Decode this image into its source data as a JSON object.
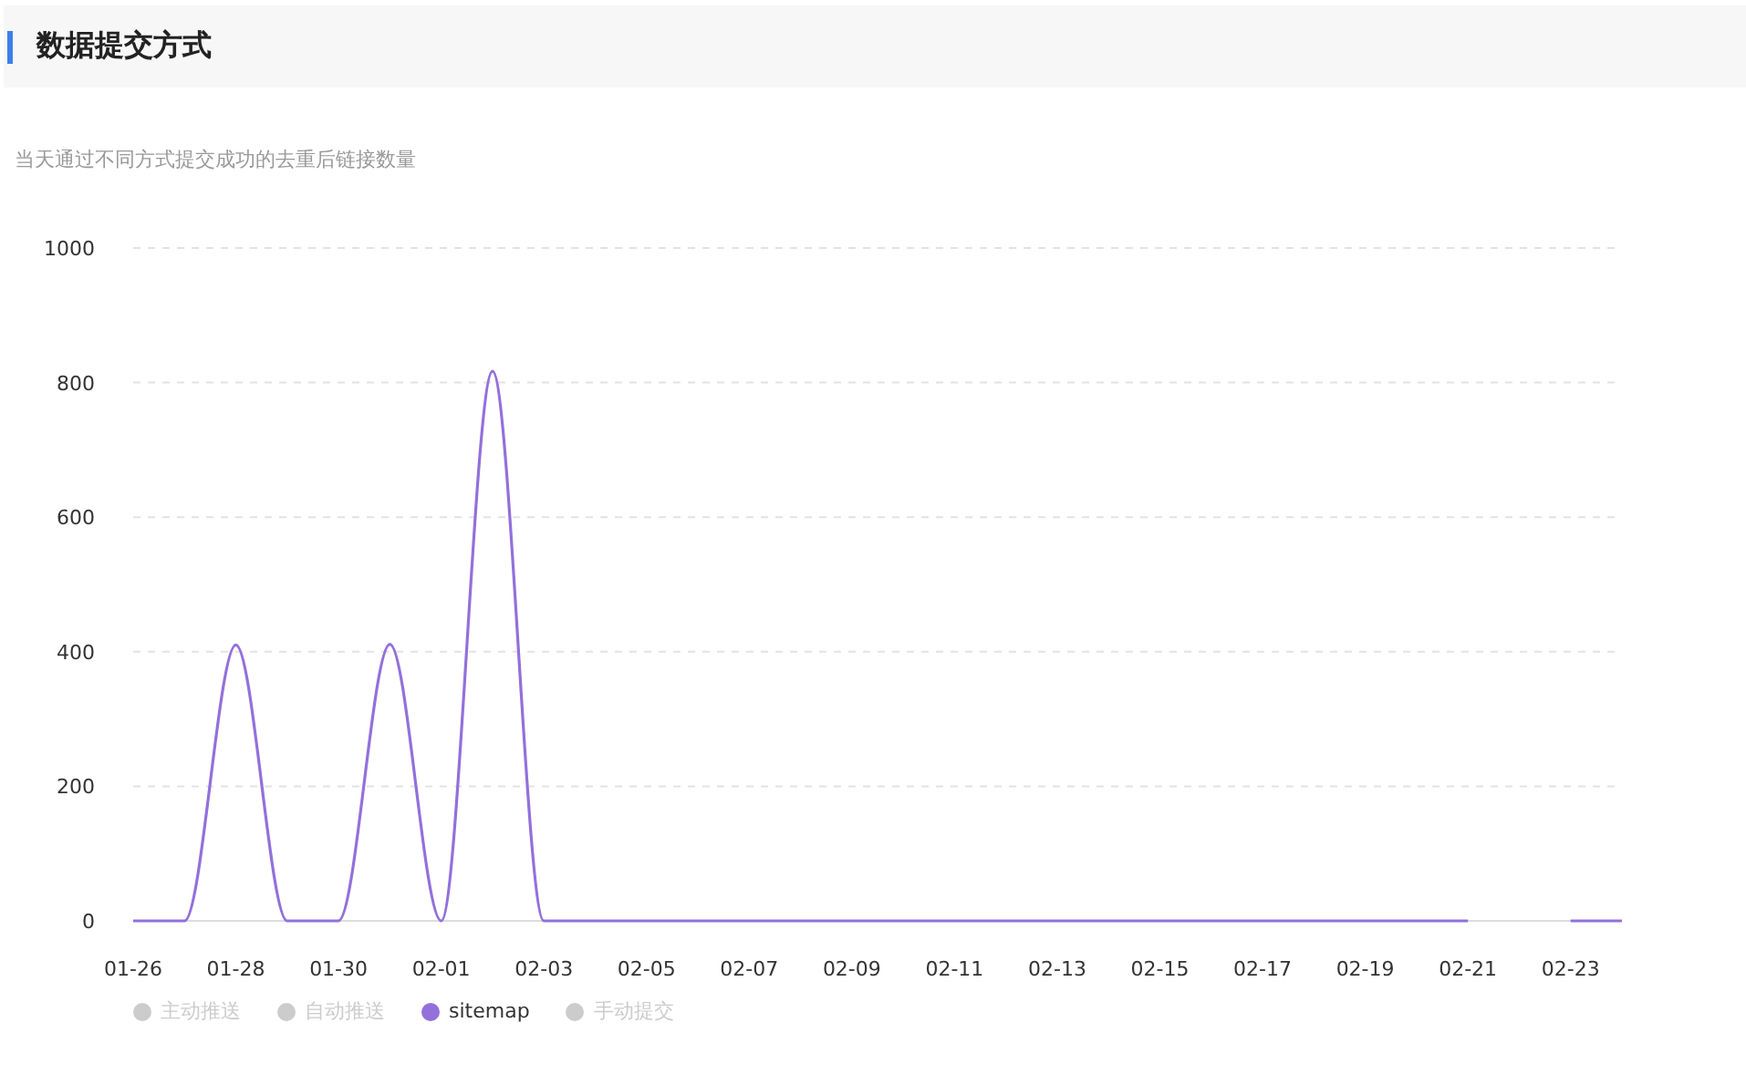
{
  "header": {
    "title": "数据提交方式"
  },
  "subtitle": "当天通过不同方式提交成功的去重后链接数量",
  "chart": {
    "chart_data": {
      "type": "line",
      "grid": true,
      "categories": [
        "01-26",
        null,
        "01-28",
        null,
        "01-30",
        null,
        "02-01",
        null,
        "02-03",
        null,
        "02-05",
        null,
        "02-07",
        null,
        "02-09",
        null,
        "02-11",
        null,
        "02-13",
        null,
        "02-15",
        null,
        "02-17",
        null,
        "02-19",
        null,
        "02-21",
        null,
        "02-23",
        null
      ],
      "ylim": [
        0,
        1000
      ],
      "yticks": [
        0,
        200,
        400,
        600,
        800,
        1000
      ],
      "series": [
        {
          "name": "sitemap",
          "color": "#9370db",
          "values": [
            0,
            0,
            410,
            0,
            0,
            411,
            0,
            817,
            0,
            0,
            0,
            0,
            0,
            0,
            0,
            0,
            0,
            0,
            0,
            0,
            0,
            0,
            0,
            0,
            0,
            0,
            0,
            null,
            0,
            0
          ]
        }
      ]
    },
    "legend": [
      {
        "kind": "hidden",
        "label": "主动推送",
        "selected": false,
        "color": "#cccccc"
      },
      {
        "kind": "hidden",
        "label": "自动推送",
        "selected": false,
        "color": "#cccccc"
      },
      {
        "kind": "series",
        "selected": true
      },
      {
        "kind": "hidden",
        "label": "手动提交",
        "selected": false,
        "color": "#cccccc"
      }
    ]
  }
}
